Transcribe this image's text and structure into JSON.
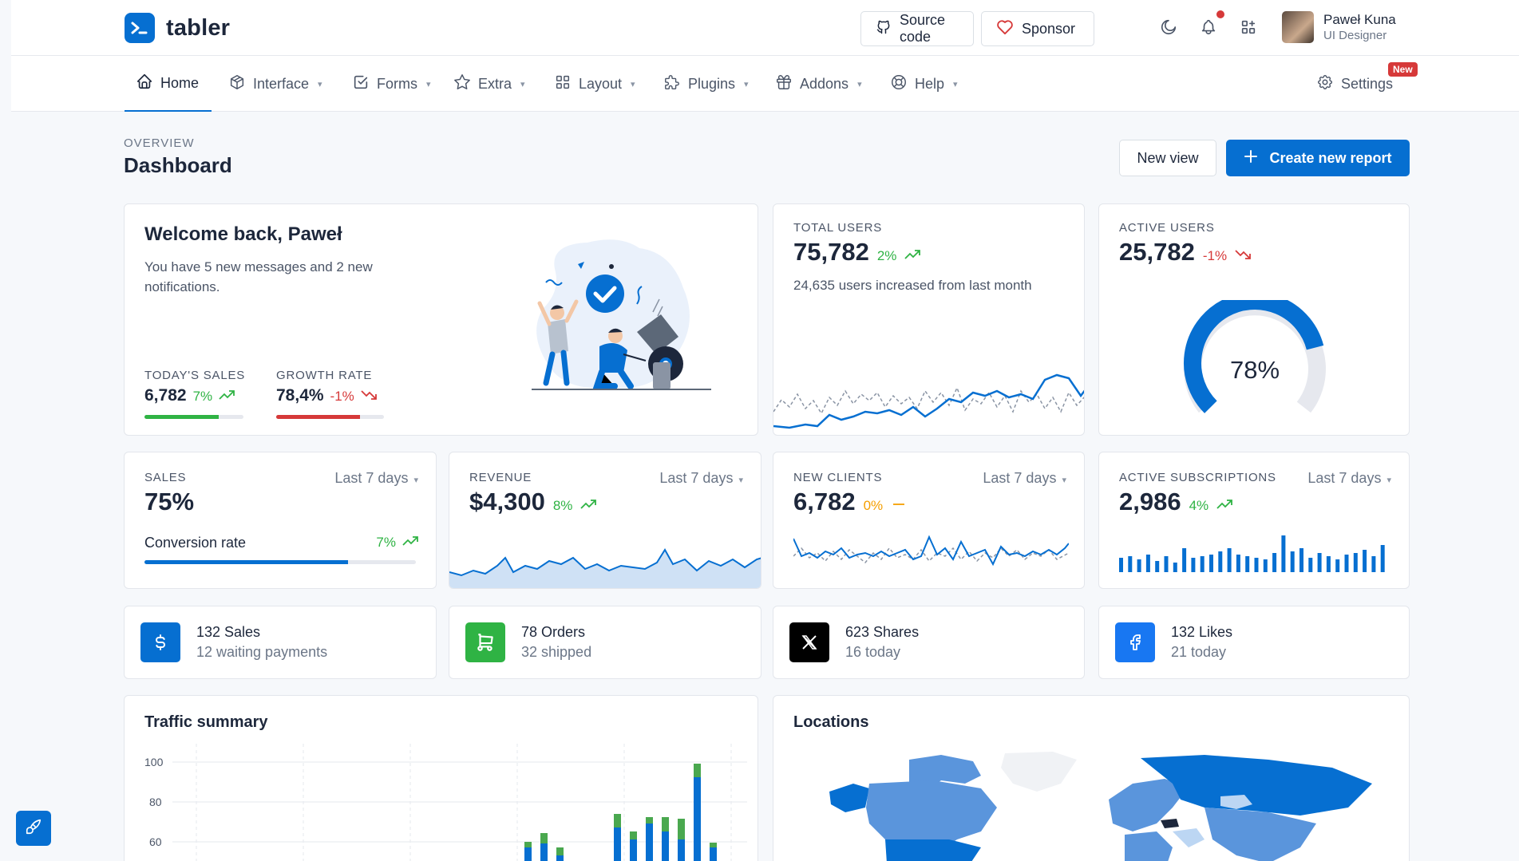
{
  "brand": {
    "name": "tabler",
    "color": "#066fd1"
  },
  "header": {
    "source_code_label": "Source code",
    "sponsor_label": "Sponsor",
    "user": {
      "name": "Paweł Kuna",
      "role": "UI Designer"
    }
  },
  "nav": {
    "items": [
      {
        "label": "Home",
        "icon": "home-icon",
        "active": true
      },
      {
        "label": "Interface",
        "icon": "package-icon"
      },
      {
        "label": "Forms",
        "icon": "checkbox-icon"
      },
      {
        "label": "Extra",
        "icon": "star-icon"
      },
      {
        "label": "Layout",
        "icon": "layout-icon"
      },
      {
        "label": "Plugins",
        "icon": "puzzle-icon"
      },
      {
        "label": "Addons",
        "icon": "gift-icon"
      },
      {
        "label": "Help",
        "icon": "lifebuoy-icon"
      }
    ],
    "settings_label": "Settings",
    "settings_badge": "New"
  },
  "page": {
    "pretitle": "OVERVIEW",
    "title": "Dashboard",
    "new_view_label": "New view",
    "create_report_label": "Create new report"
  },
  "welcome": {
    "title": "Welcome back, Paweł",
    "text": "You have 5 new messages and 2 new notifications.",
    "todays_sales": {
      "label": "TODAY'S SALES",
      "value": "6,782",
      "change": "7%",
      "progress": 0.75
    },
    "growth_rate": {
      "label": "GROWTH RATE",
      "value": "78,4%",
      "change": "-1%",
      "progress": 0.78
    }
  },
  "total_users": {
    "label": "TOTAL USERS",
    "value": "75,782",
    "change": "2%",
    "note": "24,635 users increased from last month"
  },
  "active_users": {
    "label": "ACTIVE USERS",
    "value": "25,782",
    "change": "-1%",
    "gauge_value": "78%",
    "gauge_fraction": 0.78
  },
  "sales": {
    "label": "SALES",
    "period": "Last 7 days",
    "value": "75%",
    "sub_label": "Conversion rate",
    "sub_change": "7%",
    "progress": 0.75
  },
  "revenue": {
    "label": "REVENUE",
    "period": "Last 7 days",
    "value": "$4,300",
    "change": "8%"
  },
  "new_clients": {
    "label": "NEW CLIENTS",
    "period": "Last 7 days",
    "value": "6,782",
    "change": "0%"
  },
  "active_subscriptions": {
    "label": "ACTIVE SUBSCRIPTIONS",
    "period": "Last 7 days",
    "value": "2,986",
    "change": "4%"
  },
  "stat_cards": [
    {
      "line1": "132 Sales",
      "line2": "12 waiting payments",
      "icon": "currency-dollar-icon",
      "color": "#066fd1"
    },
    {
      "line1": "78 Orders",
      "line2": "32 shipped",
      "icon": "shopping-cart-icon",
      "color": "#2fb344"
    },
    {
      "line1": "623 Shares",
      "line2": "16 today",
      "icon": "x-logo-icon",
      "color": "#000000"
    },
    {
      "line1": "132 Likes",
      "line2": "21 today",
      "icon": "facebook-icon",
      "color": "#1877f2"
    }
  ],
  "traffic": {
    "title": "Traffic summary",
    "y_ticks": [
      "100",
      "80",
      "60"
    ]
  },
  "locations": {
    "title": "Locations"
  }
}
